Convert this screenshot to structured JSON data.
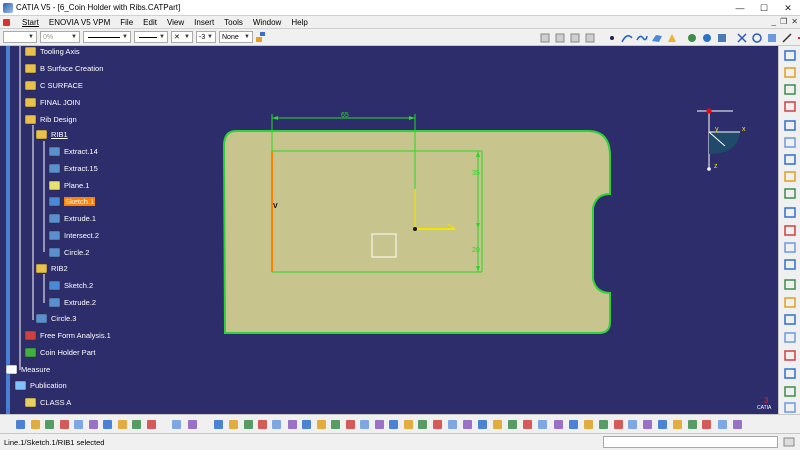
{
  "window": {
    "title": "CATIA V5 - [6_Coin Holder with Ribs.CATPart]",
    "controls": {
      "minimize": "—",
      "maximize": "☐",
      "close": "✕"
    }
  },
  "menubar": {
    "items": [
      "Start",
      "ENOVIA V5 VPM",
      "File",
      "Edit",
      "View",
      "Insert",
      "Tools",
      "Window",
      "Help"
    ],
    "doc_controls": {
      "minimize": "_",
      "restore": "❐",
      "close": "✕"
    }
  },
  "properties_toolbar": {
    "fill_color": "",
    "transparency": "0%",
    "line_thickness": "",
    "line_type": "",
    "point_symbol": "",
    "layer_value": "-3",
    "rendering_style": "None"
  },
  "tree": {
    "items": [
      {
        "label": "Tooling Axis",
        "icon": "geometrical-set-icon"
      },
      {
        "label": "B Surface Creation",
        "icon": "geometrical-set-icon"
      },
      {
        "label": "C SURFACE",
        "icon": "geometrical-set-icon"
      },
      {
        "label": "FINAL JOIN",
        "icon": "geometrical-set-icon"
      },
      {
        "label": "Rib Design",
        "icon": "geometrical-set-icon"
      },
      {
        "label": "RIB1",
        "icon": "geometrical-set-icon"
      },
      {
        "label": "Extract.14",
        "icon": "extract-icon"
      },
      {
        "label": "Extract.15",
        "icon": "extract-icon"
      },
      {
        "label": "Plane.1",
        "icon": "plane-icon"
      },
      {
        "label": "Sketch.1",
        "icon": "sketch-icon"
      },
      {
        "label": "Extrude.1",
        "icon": "extrude-icon"
      },
      {
        "label": "Intersect.2",
        "icon": "intersect-icon"
      },
      {
        "label": "Circle.2",
        "icon": "circle-icon"
      },
      {
        "label": "RIB2",
        "icon": "geometrical-set-icon"
      },
      {
        "label": "Sketch.2",
        "icon": "sketch-icon"
      },
      {
        "label": "Extrude.2",
        "icon": "extrude-icon"
      },
      {
        "label": "Circle.3",
        "icon": "circle-icon"
      },
      {
        "label": "Free Form Analysis.1",
        "icon": "analysis-icon"
      },
      {
        "label": "Coin Holder Part",
        "icon": "part-body-icon"
      },
      {
        "label": "Measure",
        "icon": "measure-icon"
      },
      {
        "label": "Publication",
        "icon": "publication-icon"
      },
      {
        "label": "CLASS A",
        "icon": "class-icon"
      }
    ]
  },
  "sketch": {
    "dimensions": {
      "width": "65",
      "height": "35",
      "bottom": "20"
    },
    "axis_label": "V",
    "compass": {
      "x": "x",
      "y": "y",
      "z": "z"
    }
  },
  "brand": {
    "name": "CATIA",
    "number": "3"
  },
  "statusbar": {
    "message": "Line.1/Sketch.1/RIB1 selected"
  },
  "colors": {
    "background": "#2d2d6b",
    "surface_fill": "#c7c48d",
    "surface_edge": "#2ed13a",
    "selection": "#ff7f00",
    "sketch_line": "#28d928",
    "axis_yellow": "#f2e600"
  }
}
